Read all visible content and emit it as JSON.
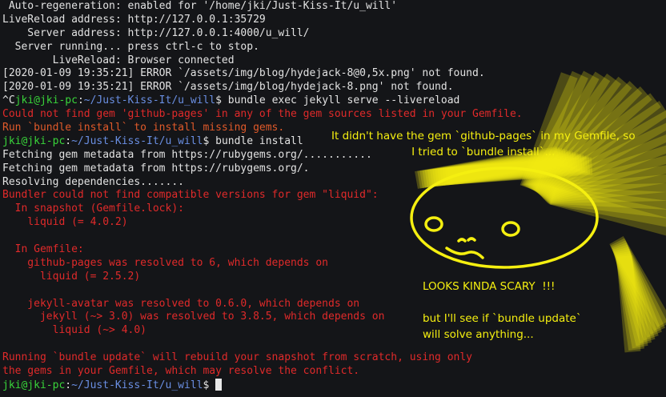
{
  "terminal": {
    "lines": [
      {
        "segments": [
          {
            "c": "white",
            "t": " Auto-regeneration: enabled for '/home/jki/Just-Kiss-It/u_will'"
          }
        ]
      },
      {
        "segments": [
          {
            "c": "white",
            "t": "LiveReload address: http://127.0.0.1:35729"
          }
        ]
      },
      {
        "segments": [
          {
            "c": "white",
            "t": "    Server address: http://127.0.0.1:4000/u_will/"
          }
        ]
      },
      {
        "segments": [
          {
            "c": "white",
            "t": "  Server running... press ctrl-c to stop."
          }
        ]
      },
      {
        "segments": [
          {
            "c": "white",
            "t": "        LiveReload: Browser connected"
          }
        ]
      },
      {
        "segments": [
          {
            "c": "white",
            "t": "[2020-01-09 19:35:21] ERROR `/assets/img/blog/hydejack-8@0,5x.png' not found."
          }
        ]
      },
      {
        "segments": [
          {
            "c": "white",
            "t": "[2020-01-09 19:35:21] ERROR `/assets/img/blog/hydejack-8.png' not found."
          }
        ]
      },
      {
        "segments": [
          {
            "c": "white",
            "t": "^C"
          },
          {
            "c": "green",
            "t": "jki@jki-pc"
          },
          {
            "c": "white",
            "t": ":"
          },
          {
            "c": "blue",
            "t": "~/Just-Kiss-It/u_will"
          },
          {
            "c": "white",
            "t": "$ bundle exec jekyll serve --livereload"
          }
        ]
      },
      {
        "segments": [
          {
            "c": "red",
            "t": "Could not find gem 'github-pages' in any of the gem sources listed in your Gemfile."
          }
        ]
      },
      {
        "segments": [
          {
            "c": "orange",
            "t": "Run `bundle install` to install missing gems."
          }
        ]
      },
      {
        "segments": [
          {
            "c": "green",
            "t": "jki@jki-pc"
          },
          {
            "c": "white",
            "t": ":"
          },
          {
            "c": "blue",
            "t": "~/Just-Kiss-It/u_will"
          },
          {
            "c": "white",
            "t": "$ bundle install"
          }
        ]
      },
      {
        "segments": [
          {
            "c": "white",
            "t": "Fetching gem metadata from https://rubygems.org/..........."
          }
        ]
      },
      {
        "segments": [
          {
            "c": "white",
            "t": "Fetching gem metadata from https://rubygems.org/."
          }
        ]
      },
      {
        "segments": [
          {
            "c": "white",
            "t": "Resolving dependencies......."
          }
        ]
      },
      {
        "segments": [
          {
            "c": "red",
            "t": "Bundler could not find compatible versions for gem \"liquid\":"
          }
        ]
      },
      {
        "segments": [
          {
            "c": "red",
            "t": "  In snapshot (Gemfile.lock):"
          }
        ]
      },
      {
        "segments": [
          {
            "c": "red",
            "t": "    liquid (= 4.0.2)"
          }
        ]
      },
      {
        "segments": [
          {
            "c": "red",
            "t": ""
          }
        ]
      },
      {
        "segments": [
          {
            "c": "red",
            "t": "  In Gemfile:"
          }
        ]
      },
      {
        "segments": [
          {
            "c": "red",
            "t": "    github-pages was resolved to 6, which depends on"
          }
        ]
      },
      {
        "segments": [
          {
            "c": "red",
            "t": "      liquid (= 2.5.2)"
          }
        ]
      },
      {
        "segments": [
          {
            "c": "red",
            "t": ""
          }
        ]
      },
      {
        "segments": [
          {
            "c": "red",
            "t": "    jekyll-avatar was resolved to 0.6.0, which depends on"
          }
        ]
      },
      {
        "segments": [
          {
            "c": "red",
            "t": "      jekyll (~> 3.0) was resolved to 3.8.5, which depends on"
          }
        ]
      },
      {
        "segments": [
          {
            "c": "red",
            "t": "        liquid (~> 4.0)"
          }
        ]
      },
      {
        "segments": [
          {
            "c": "red",
            "t": ""
          }
        ]
      },
      {
        "segments": [
          {
            "c": "red",
            "t": "Running `bundle update` will rebuild your snapshot from scratch, using only"
          }
        ]
      },
      {
        "segments": [
          {
            "c": "red",
            "t": "the gems in your Gemfile, which may resolve the conflict."
          }
        ]
      }
    ],
    "prompt": {
      "user_host": "jki@jki-pc",
      "sep": ":",
      "path": "~/Just-Kiss-It/u_will",
      "symbol": "$ "
    }
  },
  "annotations": {
    "top_note": "It didn't have the gem `github-pages` in my Gemfile, so\nI tried to `bundle install`...",
    "scary_note": "LOOKS KINDA SCARY  !!!",
    "update_note": "but I'll see if `bundle update`\nwill solve anything..."
  },
  "colors": {
    "background": "#141518",
    "annotation": "#f5ef10",
    "error_red": "#e02a2a",
    "prompt_green": "#39d43a",
    "path_blue": "#6a8fe3"
  }
}
